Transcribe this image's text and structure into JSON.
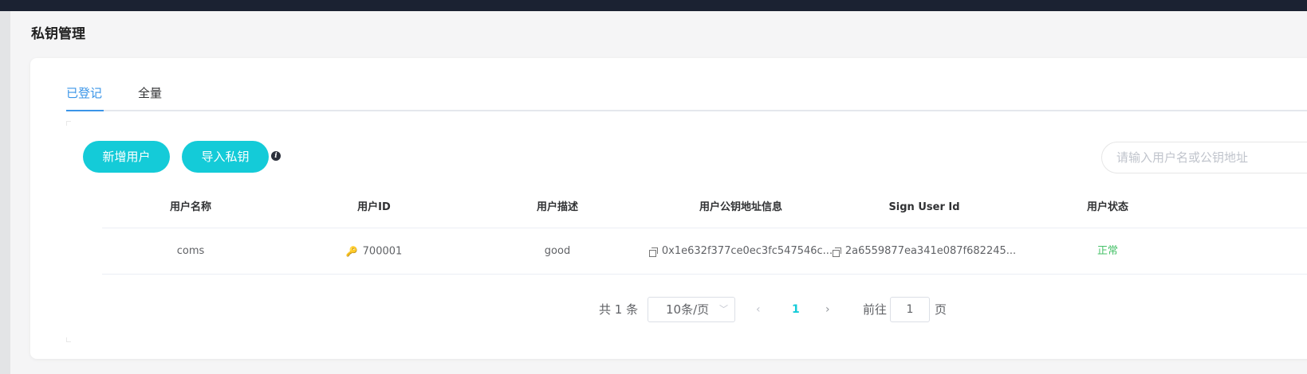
{
  "page": {
    "title": "私钥管理"
  },
  "tabs": [
    {
      "label": "已登记",
      "active": true
    },
    {
      "label": "全量",
      "active": false
    }
  ],
  "toolbar": {
    "add_user_label": "新增用户",
    "import_key_label": "导入私钥",
    "info_glyph": "i",
    "search_placeholder": "请输入用户名或公钥地址"
  },
  "table": {
    "columns": [
      "用户名称",
      "用户ID",
      "用户描述",
      "用户公钥地址信息",
      "Sign User Id",
      "用户状态"
    ],
    "rows": [
      {
        "name": "coms",
        "id": "700001",
        "description": "good",
        "public_key": "0x1e632f377ce0ec3fc547546c...",
        "sign_user_id": "2a6559877ea341e087f682245...",
        "status": "正常"
      }
    ]
  },
  "pagination": {
    "total": "共 1 条",
    "page_size": "10条/页",
    "current_page": "1",
    "goto_label": "前往",
    "goto_value": "1",
    "page_suffix": "页"
  },
  "colors": {
    "accent": "#14cbd8",
    "tab_active": "#3a95e8",
    "status_ok": "#48c26a",
    "topbar": "#1b2232"
  },
  "icons": {
    "key": "key-icon",
    "copy": "copy-icon",
    "info": "info-icon",
    "chevron": "chevron-down-icon"
  }
}
